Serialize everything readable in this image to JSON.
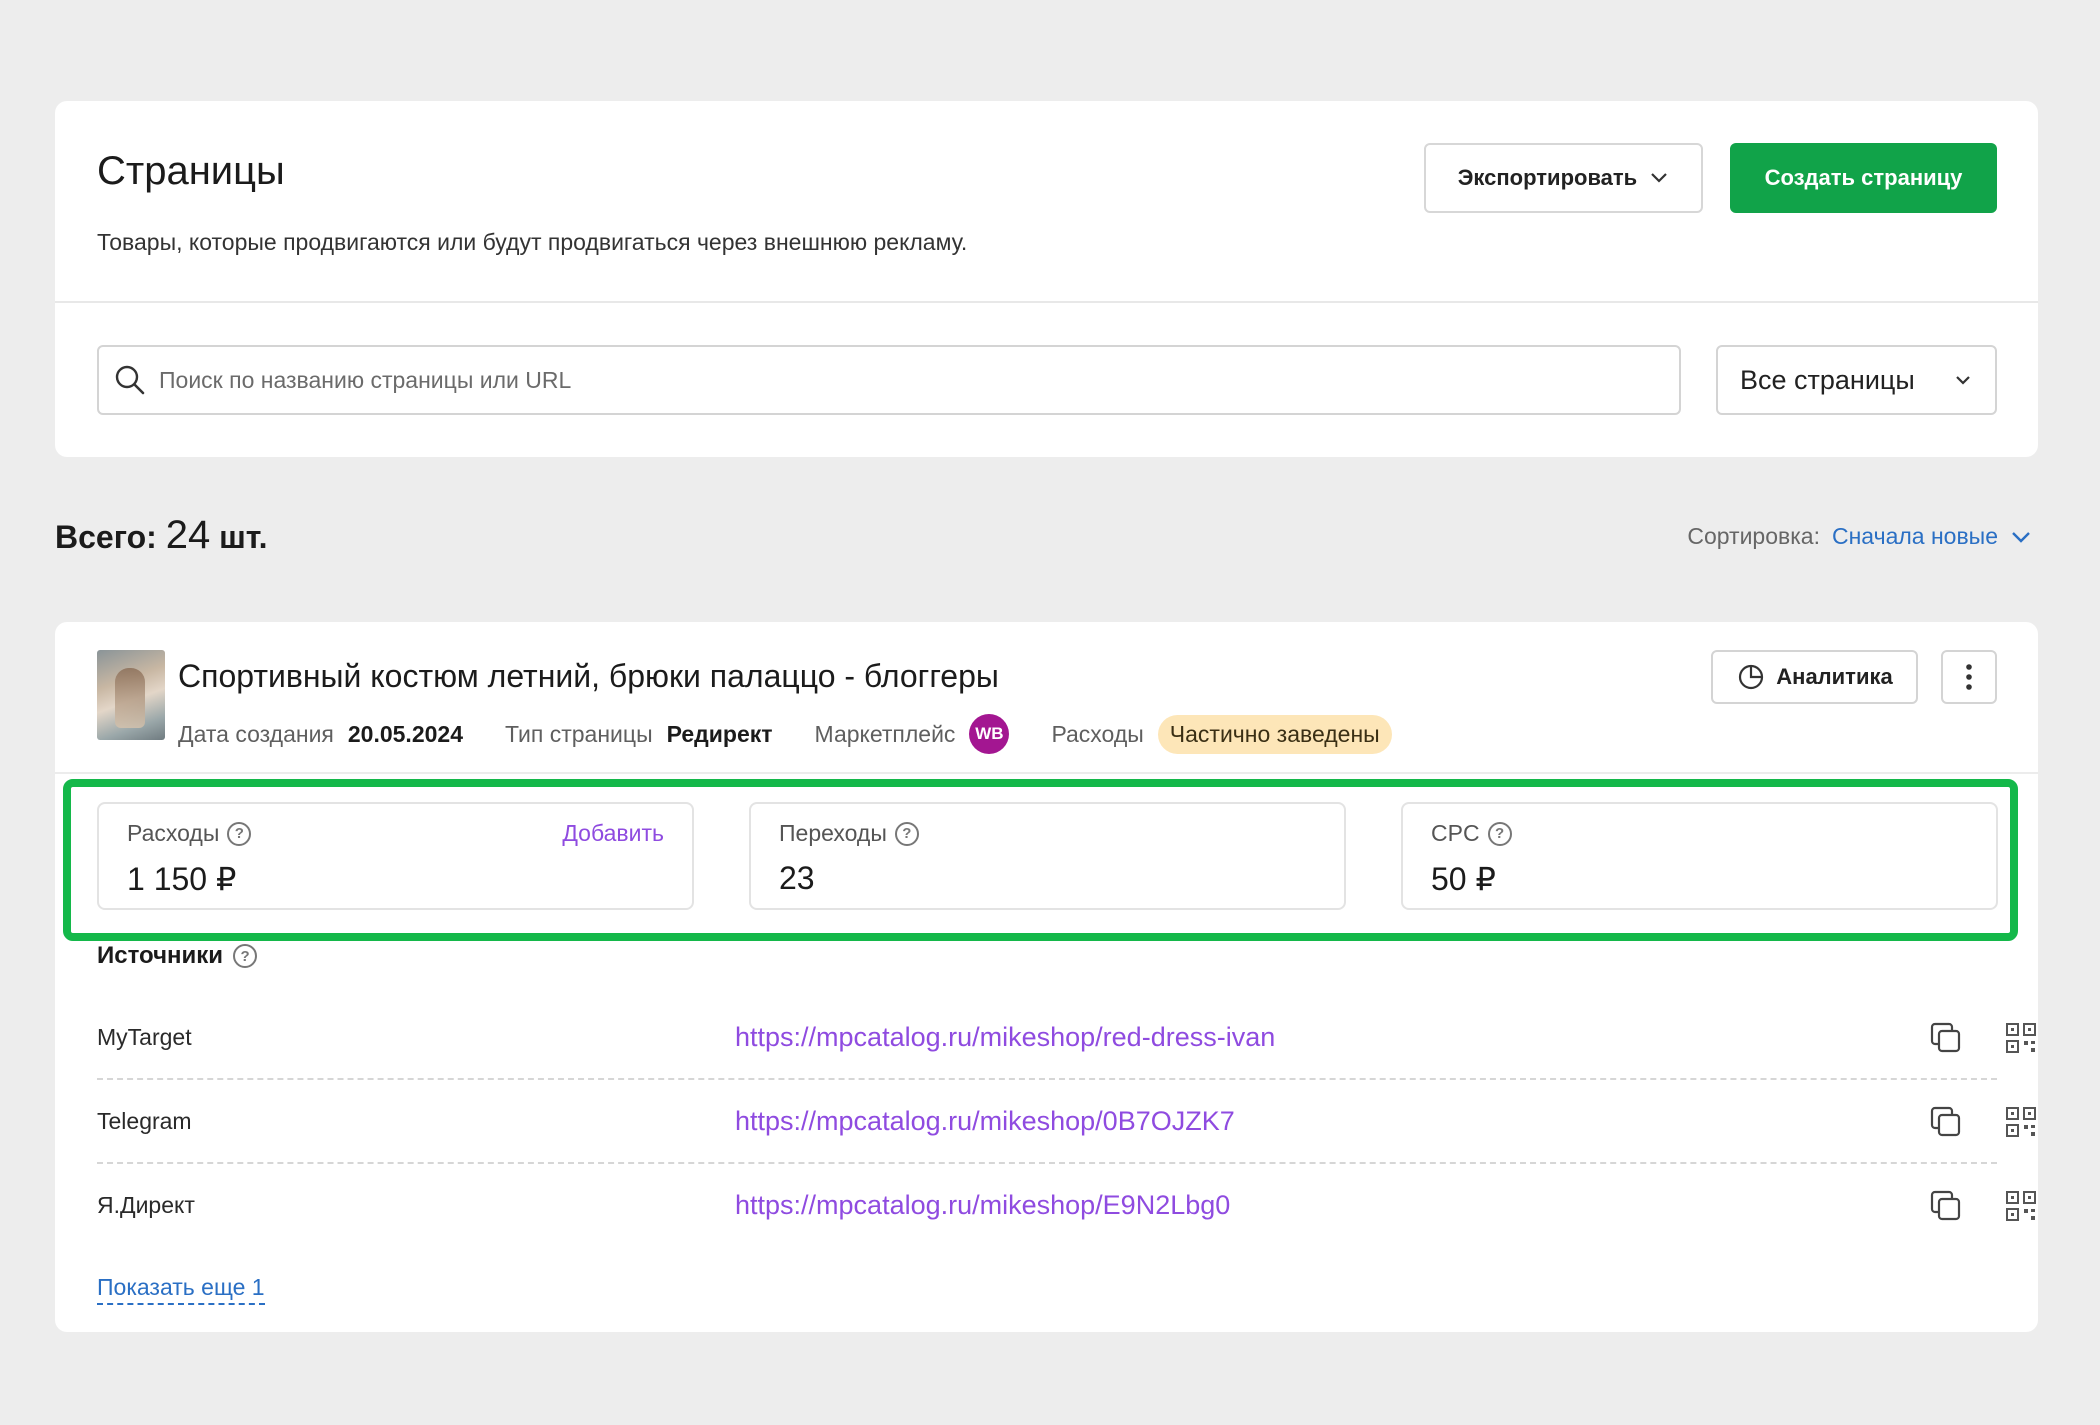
{
  "header": {
    "title": "Страницы",
    "subtitle": "Товары, которые продвигаются или будут продвигаться через внешнюю рекламу.",
    "export_label": "Экспортировать",
    "create_label": "Создать страницу"
  },
  "search": {
    "placeholder": "Поиск по названию страницы или URL",
    "value": ""
  },
  "filter": {
    "selected": "Все страницы"
  },
  "summary": {
    "total_prefix": "Всего:",
    "total_count": "24",
    "total_unit": "шт.",
    "sort_label": "Сортировка:",
    "sort_value": "Сначала новые"
  },
  "item": {
    "title": "Спортивный костюм летний, брюки палаццо - блоггеры",
    "created_label": "Дата создания",
    "created_value": "20.05.2024",
    "type_label": "Тип страницы",
    "type_value": "Редирект",
    "marketplace_label": "Маркетплейс",
    "marketplace_badge": "WB",
    "expenses_label": "Расходы",
    "expenses_status": "Частично заведены",
    "analytics_label": "Аналитика",
    "stats": [
      {
        "label": "Расходы",
        "value": "1 150 ₽",
        "action": "Добавить"
      },
      {
        "label": "Переходы",
        "value": "23"
      },
      {
        "label": "CPC",
        "value": "50 ₽"
      }
    ],
    "sources_title": "Источники",
    "sources": [
      {
        "name": "MyTarget",
        "url": "https://mpcatalog.ru/mikeshop/red-dress-ivan"
      },
      {
        "name": "Telegram",
        "url": "https://mpcatalog.ru/mikeshop/0B7OJZK7"
      },
      {
        "name": "Я.Директ",
        "url": "https://mpcatalog.ru/mikeshop/E9N2Lbg0"
      }
    ],
    "show_more": "Показать еще 1"
  },
  "colors": {
    "primary_green": "#11a349",
    "highlight_green": "#14b84a",
    "link_blue": "#2a6fc4",
    "link_purple": "#8f4be0",
    "wb_purple": "#a31691",
    "status_bg": "#fde6b8"
  },
  "icons": [
    "chevron-down-icon",
    "search-icon",
    "pie-chart-icon",
    "more-vertical-icon",
    "help-icon",
    "copy-icon",
    "qr-code-icon"
  ]
}
